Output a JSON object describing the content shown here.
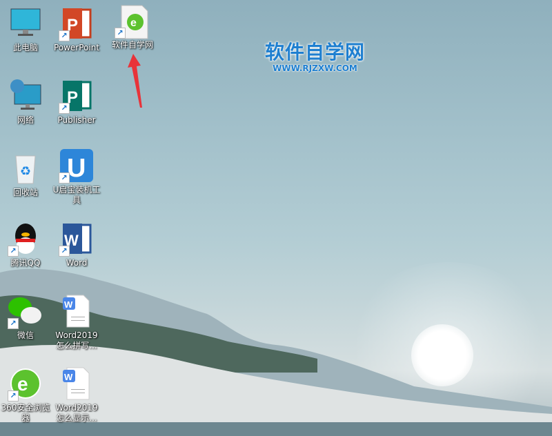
{
  "desktop": {
    "icons": [
      {
        "label": "此电脑",
        "icon": "computer-icon"
      },
      {
        "label": "PowerPoint",
        "icon": "powerpoint-icon"
      },
      {
        "label": "软件自学网",
        "icon": "360-browser-file-icon"
      },
      {
        "label": "网络",
        "icon": "network-icon"
      },
      {
        "label": "Publisher",
        "icon": "publisher-icon"
      },
      {
        "label": "回收站",
        "icon": "recycle-bin-icon"
      },
      {
        "label": "U启宝装机工具",
        "icon": "u-tool-icon"
      },
      {
        "label": "腾讯QQ",
        "icon": "qq-icon"
      },
      {
        "label": "Word",
        "icon": "word-icon"
      },
      {
        "label": "微信",
        "icon": "wechat-icon"
      },
      {
        "label": "Word2019怎么拼写...",
        "icon": "word-doc-icon"
      },
      {
        "label": "360安全浏览器",
        "icon": "360-browser-icon"
      },
      {
        "label": "Word2019怎么显示...",
        "icon": "word-doc-icon"
      }
    ]
  },
  "watermark": {
    "title": "软件自学网",
    "url": "WWW.RJZXW.COM"
  },
  "colors": {
    "arrow": "#e8333a",
    "watermark": "#1e7fd0"
  }
}
